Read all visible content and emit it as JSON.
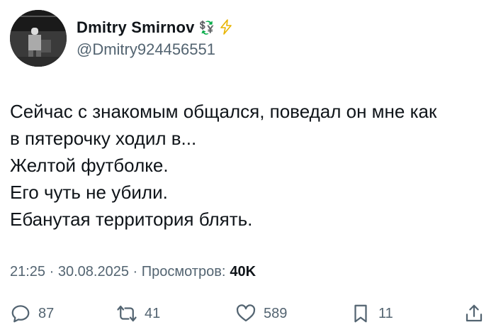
{
  "author": {
    "display_name": "Dmitry Smirnov",
    "badge_emoji": "💱",
    "lightning_emoji": "⚡",
    "handle": "@Dmitry924456551",
    "avatar_icon": "user-photo-avatar"
  },
  "tweet": {
    "lines": [
      "Сейчас с знакомым общался, поведал он мне как",
      "в пятерочку ходил в...",
      "Желтой футболке.",
      "Его чуть не убили.",
      "Ебанутая территория блять."
    ]
  },
  "meta": {
    "time": "21:25",
    "separator1": " · ",
    "date": "30.08.2025",
    "separator2": " · ",
    "views_label": "Просмотров:",
    "views_count": "40K"
  },
  "actions": {
    "reply_count": "87",
    "retweet_count": "41",
    "like_count": "589",
    "bookmark_count": "11"
  },
  "colors": {
    "text": "#0f1419",
    "secondary": "#536471",
    "lightning": "#f4c430"
  }
}
